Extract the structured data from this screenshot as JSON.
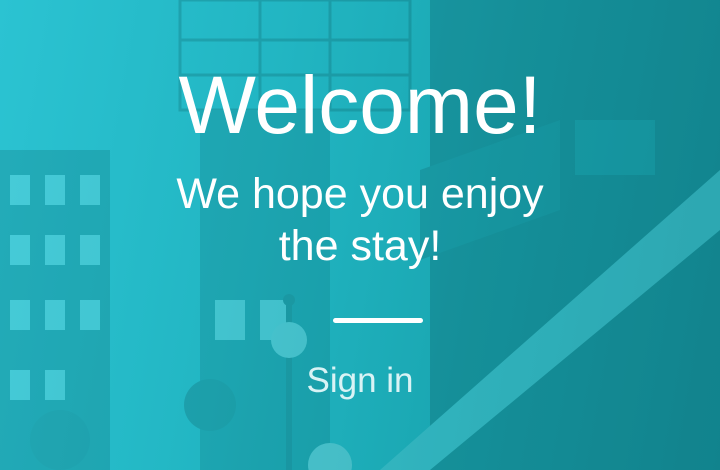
{
  "welcome": {
    "title": "Welcome!",
    "subtitle": "We hope you enjoy the stay!",
    "sign_in_label": "Sign in"
  },
  "colors": {
    "background": "#22b6c3",
    "text": "#ffffff",
    "divider": "#ffffff"
  }
}
